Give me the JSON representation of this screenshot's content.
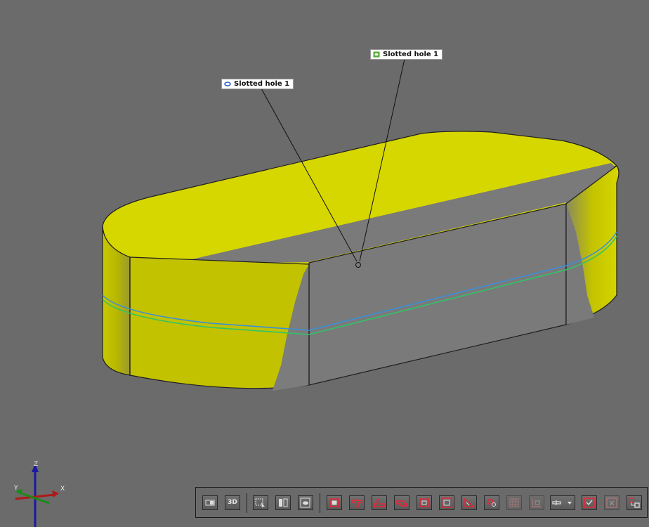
{
  "viewport": {
    "background": "#6b6b6b",
    "part_color": "#d4d400",
    "cut_face_color": "#7a7a7a",
    "edge_color": "#1e1e1e",
    "section_line_colors": [
      "#3a8fd9",
      "#2fc46a"
    ]
  },
  "callouts": [
    {
      "text": "Slotted hole 1",
      "icon": "slot-outline-icon"
    },
    {
      "text": "Slotted hole 1",
      "icon": "slot-feature-icon"
    }
  ],
  "triad": {
    "z_label": "Z",
    "y_label": "Y",
    "x_label": "X"
  },
  "toolbar": {
    "buttons": [
      {
        "name": "viewport-layout-button",
        "icon": "window-layout-icon"
      },
      {
        "name": "3d-view-button",
        "text": "3D",
        "icon": "3d-view-icon"
      },
      {
        "name": "select-entities-button",
        "icon": "select-cursor-icon"
      },
      {
        "name": "section-view-button",
        "icon": "section-view-icon"
      },
      {
        "name": "hide-show-button",
        "icon": "visibility-icon"
      },
      {
        "name": "show-bounding-button",
        "icon": "bounding-box-icon"
      },
      {
        "name": "show-holes-button",
        "icon": "hole-icon"
      },
      {
        "name": "show-steps-button",
        "icon": "step-icon"
      },
      {
        "name": "show-slots-button",
        "icon": "slot-icon"
      },
      {
        "name": "show-pockets-button",
        "icon": "pocket-icon"
      },
      {
        "name": "show-frames-button",
        "icon": "frame-icon"
      },
      {
        "name": "show-chamfers-button",
        "icon": "chamfer-icon"
      },
      {
        "name": "show-patterns-button",
        "icon": "pattern-icon"
      },
      {
        "name": "show-grid-button",
        "icon": "grid-icon",
        "disabled": true
      },
      {
        "name": "show-corners-button",
        "icon": "corner-icon",
        "disabled": true
      },
      {
        "name": "feature-filter-dropdown",
        "icon": "filter-dropdown-icon"
      },
      {
        "name": "confirm-features-button",
        "icon": "check-square-icon"
      },
      {
        "name": "clear-features-button",
        "icon": "cross-square-icon",
        "disabled": true
      },
      {
        "name": "feature-tree-button",
        "icon": "tree-icon"
      }
    ]
  }
}
